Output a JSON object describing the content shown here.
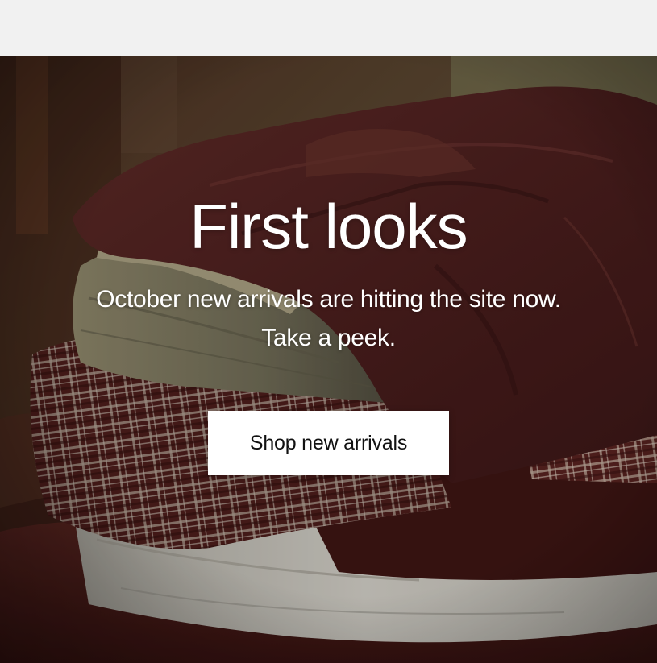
{
  "hero": {
    "title": "First looks",
    "subtitle": "October new arrivals are hitting the site now.",
    "subtitle_line2": "Take a peek.",
    "cta_label": "Shop new arrivals",
    "image_semantic": "stack of folded burgundy, plaid, khaki and white shirts"
  },
  "colors": {
    "page_background": "#f1f1f1",
    "hero_text": "#ffffff",
    "button_background": "#ffffff",
    "button_text": "#111111"
  }
}
